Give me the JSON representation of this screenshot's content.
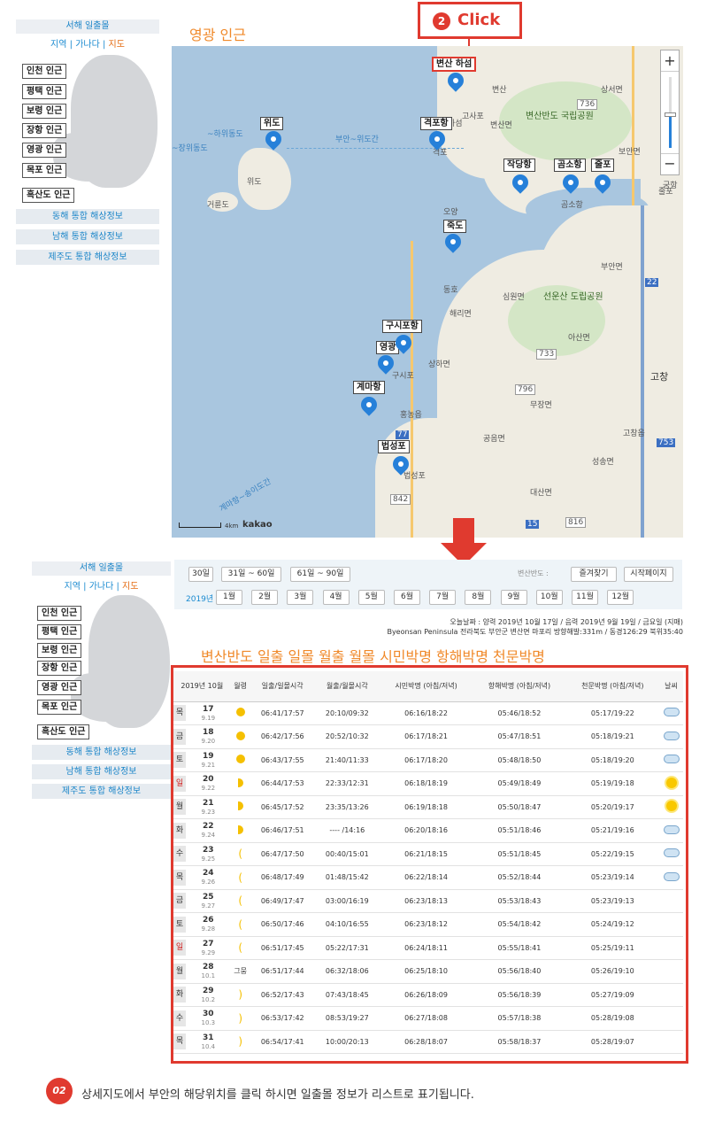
{
  "nav": {
    "title": "서해 일출몰",
    "links": [
      "지역",
      "가나다",
      "지도"
    ],
    "regions": [
      "인천 인근",
      "평택 인근",
      "보령 인근",
      "장항 인근",
      "영광 인근",
      "목포 인근",
      "흑산도 인근"
    ],
    "ribbons": [
      "동해 통합 해상정보",
      "남해 통합 해상정보",
      "제주도 통합 해상정보"
    ]
  },
  "map": {
    "title": "영광 인근",
    "click_label": "Click",
    "click_num": "2",
    "pins": [
      "변산 하섬",
      "위도",
      "격포항",
      "작당항",
      "곰소항",
      "줄포",
      "죽도",
      "구시포항",
      "영광",
      "계마항",
      "법성포"
    ],
    "places": [
      "변산",
      "상서면",
      "하섬",
      "고사포",
      "변산면",
      "변산반도 국립공원",
      "보안면",
      "궁항",
      "격포",
      "곰소항",
      "줄포",
      "위도",
      "거륜도",
      "부안면",
      "오양",
      "동호",
      "심원면",
      "선운산 도립공원",
      "해리면",
      "아산면",
      "구시포",
      "상하면",
      "무장면",
      "고창",
      "홍농읍",
      "공음면",
      "고창읍",
      "성송면",
      "법성포",
      "대산면"
    ],
    "roads": [
      "736",
      "733",
      "796",
      "77",
      "842",
      "753",
      "816",
      "15",
      "22"
    ],
    "scale": "4km",
    "brand": "kakao",
    "ferry": "부안~위도간",
    "ferry2": "계마항~송이도간",
    "hw1": "~하위동도",
    "hw2": "~장위동도"
  },
  "lower_nav": {
    "title": "서해 일출몰",
    "links": [
      "지역",
      "가나다",
      "지도"
    ],
    "regions": [
      "인천 인근",
      "평택 인근",
      "보령 인근",
      "장항 인근",
      "영광 인근",
      "목포 인근",
      "흑산도 인근"
    ],
    "ribbons": [
      "동해 통합 해상정보",
      "남해 통합 해상정보",
      "제주도 통합 해상정보"
    ]
  },
  "periods": [
    "30일",
    "31일 ~ 60일",
    "61일 ~ 90일"
  ],
  "change_label": "변산반도 :",
  "fav_button": "즐겨찾기",
  "home_button": "시작페이지",
  "year_label": "2019년",
  "months": [
    "1월",
    "2월",
    "3월",
    "4월",
    "5월",
    "6월",
    "7월",
    "8월",
    "9월",
    "10월",
    "11월",
    "12월"
  ],
  "today": "오늘날짜 : 양력 2019년 10월 17일 / 음력 2019년 9월 19일 / 금요일 (지매)",
  "location": "Byeonsan Peninsula 전라북도 부안군 변산면 마포리 방향해발:331m / 동경126:29 북위35:40",
  "page_title": "변산반도 일출 일몰 월출 월몰 시민박명 항해박명 천문박명",
  "headers": [
    "2019년  10월",
    "월령",
    "일출/일몰시각",
    "월출/월몰시각",
    "시민박명 (아침/저녁)",
    "항해박명 (아침/저녁)",
    "천문박명 (아침/저녁)",
    "날씨"
  ],
  "rows": [
    {
      "dow": "목",
      "day": "17",
      "lunar": "9.19",
      "phase": "moon",
      "sun": "06:41/17:57",
      "moon": "20:10/09:32",
      "civil": "06:16/18:22",
      "naut": "05:46/18:52",
      "astro": "05:17/19:22",
      "w": "cloud"
    },
    {
      "dow": "금",
      "day": "18",
      "lunar": "9.20",
      "phase": "moon",
      "sun": "06:42/17:56",
      "moon": "20:52/10:32",
      "civil": "06:17/18:21",
      "naut": "05:47/18:51",
      "astro": "05:18/19:21",
      "w": "cloud"
    },
    {
      "dow": "토",
      "day": "19",
      "lunar": "9.21",
      "phase": "moon",
      "sun": "06:43/17:55",
      "moon": "21:40/11:33",
      "civil": "06:17/18:20",
      "naut": "05:48/18:50",
      "astro": "05:18/19:20",
      "w": "cloud"
    },
    {
      "dow": "일",
      "day": "20",
      "lunar": "9.22",
      "phase": "half",
      "sun": "06:44/17:53",
      "moon": "22:33/12:31",
      "civil": "06:18/18:19",
      "naut": "05:49/18:49",
      "astro": "05:19/19:18",
      "w": "sun"
    },
    {
      "dow": "월",
      "day": "21",
      "lunar": "9.23",
      "phase": "half",
      "sun": "06:45/17:52",
      "moon": "23:35/13:26",
      "civil": "06:19/18:18",
      "naut": "05:50/18:47",
      "astro": "05:20/19:17",
      "w": "sun"
    },
    {
      "dow": "화",
      "day": "22",
      "lunar": "9.24",
      "phase": "half",
      "sun": "06:46/17:51",
      "moon": "---- /14:16",
      "civil": "06:20/18:16",
      "naut": "05:51/18:46",
      "astro": "05:21/19:16",
      "w": "cloud"
    },
    {
      "dow": "수",
      "day": "23",
      "lunar": "9.25",
      "phase": "cres",
      "sun": "06:47/17:50",
      "moon": "00:40/15:01",
      "civil": "06:21/18:15",
      "naut": "05:51/18:45",
      "astro": "05:22/19:15",
      "w": "cloud"
    },
    {
      "dow": "목",
      "day": "24",
      "lunar": "9.26",
      "phase": "cres",
      "sun": "06:48/17:49",
      "moon": "01:48/15:42",
      "civil": "06:22/18:14",
      "naut": "05:52/18:44",
      "astro": "05:23/19:14",
      "w": "cloud"
    },
    {
      "dow": "금",
      "day": "25",
      "lunar": "9.27",
      "phase": "cres",
      "sun": "06:49/17:47",
      "moon": "03:00/16:19",
      "civil": "06:23/18:13",
      "naut": "05:53/18:43",
      "astro": "05:23/19:13",
      "w": ""
    },
    {
      "dow": "토",
      "day": "26",
      "lunar": "9.28",
      "phase": "cres",
      "sun": "06:50/17:46",
      "moon": "04:10/16:55",
      "civil": "06:23/18:12",
      "naut": "05:54/18:42",
      "astro": "05:24/19:12",
      "w": ""
    },
    {
      "dow": "일",
      "day": "27",
      "lunar": "9.29",
      "phase": "cres",
      "sun": "06:51/17:45",
      "moon": "05:22/17:31",
      "civil": "06:24/18:11",
      "naut": "05:55/18:41",
      "astro": "05:25/19:11",
      "w": ""
    },
    {
      "dow": "월",
      "day": "28",
      "lunar": "10.1",
      "phase": "그뭄",
      "sun": "06:51/17:44",
      "moon": "06:32/18:06",
      "civil": "06:25/18:10",
      "naut": "05:56/18:40",
      "astro": "05:26/19:10",
      "w": ""
    },
    {
      "dow": "화",
      "day": "29",
      "lunar": "10.2",
      "phase": "cres2",
      "sun": "06:52/17:43",
      "moon": "07:43/18:45",
      "civil": "06:26/18:09",
      "naut": "05:56/18:39",
      "astro": "05:27/19:09",
      "w": ""
    },
    {
      "dow": "수",
      "day": "30",
      "lunar": "10.3",
      "phase": "cres2",
      "sun": "06:53/17:42",
      "moon": "08:53/19:27",
      "civil": "06:27/18:08",
      "naut": "05:57/18:38",
      "astro": "05:28/19:08",
      "w": ""
    },
    {
      "dow": "목",
      "day": "31",
      "lunar": "10.4",
      "phase": "cres2",
      "sun": "06:54/17:41",
      "moon": "10:00/20:13",
      "civil": "06:28/18:07",
      "naut": "05:58/18:37",
      "astro": "05:28/19:07",
      "w": ""
    }
  ],
  "step_num": "02",
  "caption": "상세지도에서 부안의 해당위치를 클릭 하시면 일출몰 정보가 리스트로 표기됩니다.",
  "colors": {
    "accent": "#e03a2f",
    "title": "#f0892a",
    "link": "#1a8ad0",
    "pin": "#2680d9"
  }
}
